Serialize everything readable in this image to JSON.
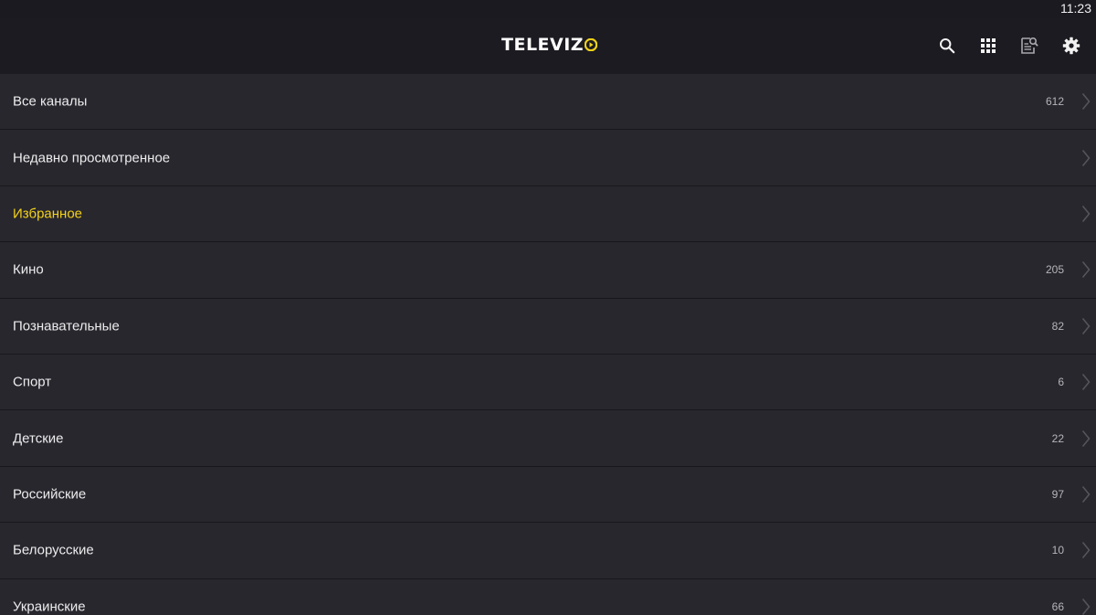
{
  "status": {
    "time": "11:23"
  },
  "header": {
    "logo_text": "TELEVIZ",
    "icons": [
      "search-icon",
      "grid-icon",
      "epg-search-icon",
      "gear-icon"
    ]
  },
  "colors": {
    "accent": "#f3d21b",
    "row_bg": "#28272e",
    "header_bg": "#1b1b21"
  },
  "categories": [
    {
      "label": "Все каналы",
      "count": "612"
    },
    {
      "label": "Недавно просмотренное",
      "count": ""
    },
    {
      "label": "Избранное",
      "count": "",
      "active": true
    },
    {
      "label": "Кино",
      "count": "205"
    },
    {
      "label": "Познавательные",
      "count": "82"
    },
    {
      "label": "Спорт",
      "count": "6"
    },
    {
      "label": "Детские",
      "count": "22"
    },
    {
      "label": "Российские",
      "count": "97"
    },
    {
      "label": "Белорусские",
      "count": "10"
    },
    {
      "label": "Украинские",
      "count": "66"
    }
  ]
}
